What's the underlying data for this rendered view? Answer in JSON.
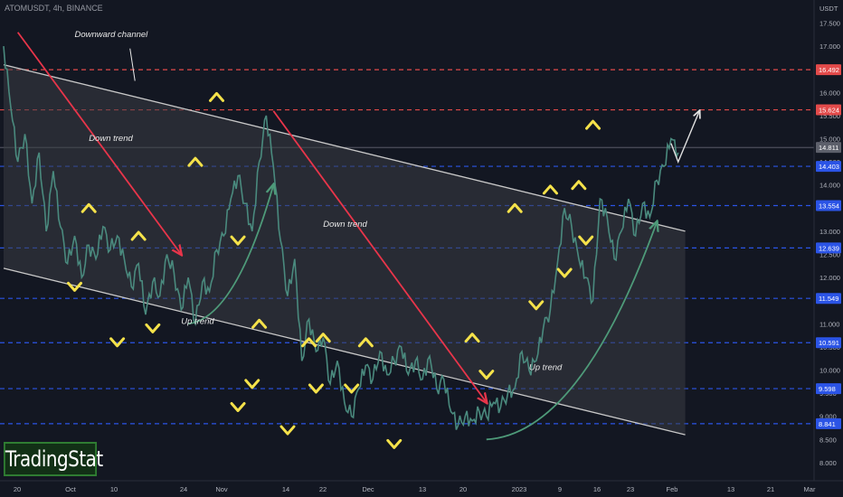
{
  "header": {
    "symbol": "ATOMUSDT, 4h, BINANCE"
  },
  "watermark": {
    "logo_text": "TradingStat"
  },
  "colors": {
    "background": "#131722",
    "candle_line": "#4a8a7e",
    "channel": "#c8c8c8",
    "down_arrow": "#e8354a",
    "up_arrow": "#4e9a79",
    "marker": "#f5e24a",
    "label_text": "#e8e8e8",
    "red_level": "#e24a4a",
    "blue_level": "#2b54e6",
    "current_price_bg": "#5d606b",
    "forecast_arrow": "#e0e0e0"
  },
  "chart_data": {
    "type": "line",
    "title": "",
    "currency": "USDT",
    "ylim": [
      7.5,
      18.0
    ],
    "y_ticks": [
      "17.500",
      "17.000",
      "16.500",
      "16.000",
      "15.500",
      "15.000",
      "14.500",
      "14.000",
      "13.500",
      "13.000",
      "12.500",
      "12.000",
      "11.500",
      "11.000",
      "10.500",
      "10.000",
      "9.500",
      "9.000",
      "8.500",
      "8.000"
    ],
    "x_ticks": [
      "20",
      "Oct",
      "10",
      "24",
      "Nov",
      "14",
      "22",
      "Dec",
      "13",
      "20",
      "2023",
      "9",
      "16",
      "23",
      "Feb",
      "13",
      "21",
      "Mar"
    ],
    "price_series": {
      "name": "",
      "points": [
        [
          0,
          17.0
        ],
        [
          1,
          15.7
        ],
        [
          2,
          14.5
        ],
        [
          3,
          15.1
        ],
        [
          4,
          13.6
        ],
        [
          5,
          14.7
        ],
        [
          6,
          13.0
        ],
        [
          7,
          14.3
        ],
        [
          8,
          13.1
        ],
        [
          9,
          12.3
        ],
        [
          10,
          12.9
        ],
        [
          11,
          12.0
        ],
        [
          12,
          12.7
        ],
        [
          13,
          12.4
        ],
        [
          14,
          13.1
        ],
        [
          15,
          12.6
        ],
        [
          16,
          12.9
        ],
        [
          17,
          12.4
        ],
        [
          18,
          11.8
        ],
        [
          19,
          12.3
        ],
        [
          20,
          11.2
        ],
        [
          21,
          11.9
        ],
        [
          22,
          11.6
        ],
        [
          23,
          12.5
        ],
        [
          24,
          12.1
        ],
        [
          25,
          11.3
        ],
        [
          26,
          12.0
        ],
        [
          27,
          11.0
        ],
        [
          28,
          11.9
        ],
        [
          29,
          11.7
        ],
        [
          30,
          12.6
        ],
        [
          31,
          12.9
        ],
        [
          32,
          13.7
        ],
        [
          33,
          14.2
        ],
        [
          34,
          13.6
        ],
        [
          35,
          13.0
        ],
        [
          36,
          14.5
        ],
        [
          37,
          15.5
        ],
        [
          38,
          14.4
        ],
        [
          39,
          12.8
        ],
        [
          40,
          11.6
        ],
        [
          41,
          12.4
        ],
        [
          42,
          10.2
        ],
        [
          43,
          11.1
        ],
        [
          44,
          10.4
        ],
        [
          45,
          10.7
        ],
        [
          46,
          9.7
        ],
        [
          47,
          10.2
        ],
        [
          48,
          9.3
        ],
        [
          49,
          9.0
        ],
        [
          50,
          9.6
        ],
        [
          51,
          10.1
        ],
        [
          52,
          9.8
        ],
        [
          53,
          10.4
        ],
        [
          54,
          9.9
        ],
        [
          55,
          10.2
        ],
        [
          56,
          10.5
        ],
        [
          57,
          9.9
        ],
        [
          58,
          10.2
        ],
        [
          59,
          9.8
        ],
        [
          60,
          10.3
        ],
        [
          61,
          9.6
        ],
        [
          62,
          9.8
        ],
        [
          63,
          9.1
        ],
        [
          64,
          8.8
        ],
        [
          65,
          9.0
        ],
        [
          66,
          8.9
        ],
        [
          67,
          9.1
        ],
        [
          68,
          9.0
        ],
        [
          69,
          9.3
        ],
        [
          70,
          9.2
        ],
        [
          71,
          9.5
        ],
        [
          72,
          9.6
        ],
        [
          73,
          10.4
        ],
        [
          74,
          10.0
        ],
        [
          75,
          10.2
        ],
        [
          76,
          10.9
        ],
        [
          77,
          11.3
        ],
        [
          78,
          12.3
        ],
        [
          79,
          13.5
        ],
        [
          80,
          13.1
        ],
        [
          81,
          12.4
        ],
        [
          82,
          12.0
        ],
        [
          83,
          11.5
        ],
        [
          84,
          13.7
        ],
        [
          85,
          13.3
        ],
        [
          86,
          12.4
        ],
        [
          87,
          13.0
        ],
        [
          88,
          13.7
        ],
        [
          89,
          12.9
        ],
        [
          90,
          13.6
        ],
        [
          91,
          13.3
        ],
        [
          92,
          14.1
        ],
        [
          93,
          14.4
        ],
        [
          94,
          15.0
        ],
        [
          95,
          14.7
        ]
      ]
    },
    "horizontal_levels": [
      {
        "price": 16.492,
        "label": "16.492",
        "color": "red"
      },
      {
        "price": 15.624,
        "label": "15.624",
        "color": "red"
      },
      {
        "price": 14.403,
        "label": "14.403",
        "color": "blue"
      },
      {
        "price": 13.554,
        "label": "13.554",
        "color": "blue"
      },
      {
        "price": 12.639,
        "label": "12.639",
        "color": "blue"
      },
      {
        "price": 11.549,
        "label": "11.549",
        "color": "blue"
      },
      {
        "price": 10.591,
        "label": "10.591",
        "color": "blue"
      },
      {
        "price": 9.598,
        "label": "9.598",
        "color": "blue"
      },
      {
        "price": 8.841,
        "label": "8.841",
        "color": "blue"
      }
    ],
    "current_price": {
      "price": 14.811,
      "label": "14.811"
    },
    "channel": {
      "upper": [
        [
          0,
          16.6
        ],
        [
          96,
          13.0
        ]
      ],
      "lower": [
        [
          0,
          12.2
        ],
        [
          96,
          8.6
        ]
      ]
    },
    "trend_arrows": [
      {
        "kind": "down",
        "from": [
          2,
          17.3
        ],
        "to": [
          25,
          12.5
        ]
      },
      {
        "kind": "down",
        "from": [
          38,
          15.6
        ],
        "to": [
          68,
          9.3
        ]
      },
      {
        "kind": "up",
        "from": [
          26,
          11.0
        ],
        "to": [
          38,
          14.0
        ]
      },
      {
        "kind": "up",
        "from": [
          68,
          8.5
        ],
        "to": [
          92,
          13.2
        ]
      }
    ],
    "forecast_arrow": [
      [
        94,
        14.9
      ],
      [
        95,
        14.5
      ],
      [
        98,
        15.6
      ]
    ],
    "annotations": [
      {
        "text": "Downward channel",
        "at": [
          10,
          17.2
        ]
      },
      {
        "text": "Down trend",
        "at": [
          12,
          14.95
        ]
      },
      {
        "text": "Down trend",
        "at": [
          45,
          13.1
        ]
      },
      {
        "text": "Up trend",
        "at": [
          25,
          11.0
        ]
      },
      {
        "text": "Up trend",
        "at": [
          74,
          10.0
        ]
      }
    ],
    "markers": [
      {
        "kind": "down",
        "at": [
          10,
          11.8
        ]
      },
      {
        "kind": "up",
        "at": [
          12,
          13.5
        ]
      },
      {
        "kind": "up",
        "at": [
          19,
          12.9
        ]
      },
      {
        "kind": "down",
        "at": [
          16,
          10.6
        ]
      },
      {
        "kind": "down",
        "at": [
          21,
          10.9
        ]
      },
      {
        "kind": "up",
        "at": [
          27,
          14.5
        ]
      },
      {
        "kind": "up",
        "at": [
          30,
          15.9
        ]
      },
      {
        "kind": "down",
        "at": [
          33,
          12.8
        ]
      },
      {
        "kind": "down",
        "at": [
          33,
          9.2
        ]
      },
      {
        "kind": "down",
        "at": [
          35,
          9.7
        ]
      },
      {
        "kind": "up",
        "at": [
          36,
          11.0
        ]
      },
      {
        "kind": "down",
        "at": [
          40,
          8.7
        ]
      },
      {
        "kind": "down",
        "at": [
          44,
          9.6
        ]
      },
      {
        "kind": "up",
        "at": [
          43,
          10.6
        ]
      },
      {
        "kind": "up",
        "at": [
          45,
          10.7
        ]
      },
      {
        "kind": "up",
        "at": [
          51,
          10.6
        ]
      },
      {
        "kind": "down",
        "at": [
          49,
          9.6
        ]
      },
      {
        "kind": "down",
        "at": [
          55,
          8.4
        ]
      },
      {
        "kind": "up",
        "at": [
          66,
          10.7
        ]
      },
      {
        "kind": "down",
        "at": [
          68,
          9.9
        ]
      },
      {
        "kind": "up",
        "at": [
          72,
          13.5
        ]
      },
      {
        "kind": "up",
        "at": [
          77,
          13.9
        ]
      },
      {
        "kind": "down",
        "at": [
          75,
          11.4
        ]
      },
      {
        "kind": "down",
        "at": [
          79,
          12.1
        ]
      },
      {
        "kind": "up",
        "at": [
          81,
          14.0
        ]
      },
      {
        "kind": "down",
        "at": [
          82,
          12.8
        ]
      },
      {
        "kind": "up",
        "at": [
          83,
          15.3
        ]
      }
    ]
  }
}
